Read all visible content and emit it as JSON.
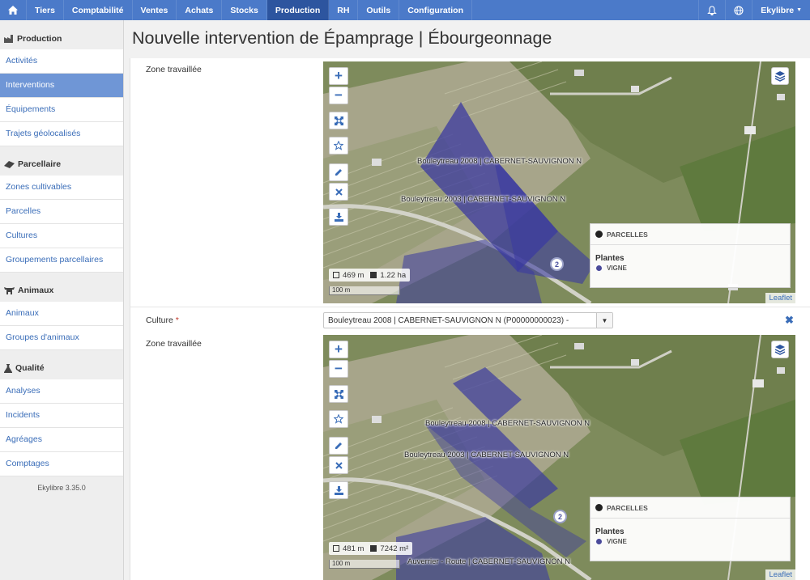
{
  "nav": {
    "items": [
      "Tiers",
      "Comptabilité",
      "Ventes",
      "Achats",
      "Stocks",
      "Production",
      "RH",
      "Outils",
      "Configuration"
    ],
    "active": "Production",
    "user": "Ekylibre"
  },
  "sidebar": {
    "sections": [
      {
        "title": "Production",
        "items": [
          "Activités",
          "Interventions",
          "Équipements",
          "Trajets géolocalisés"
        ]
      },
      {
        "title": "Parcellaire",
        "items": [
          "Zones cultivables",
          "Parcelles",
          "Cultures",
          "Groupements parcellaires"
        ]
      },
      {
        "title": "Animaux",
        "items": [
          "Animaux",
          "Groupes d'animaux"
        ]
      },
      {
        "title": "Qualité",
        "items": [
          "Analyses",
          "Incidents",
          "Agréages",
          "Comptages"
        ]
      }
    ],
    "active_item": "Interventions",
    "version": "Ekylibre 3.35.0"
  },
  "page": {
    "title": "Nouvelle intervention de Épamprage | Ébourgeonnage"
  },
  "form": {
    "zone_label": "Zone travaillée",
    "culture_label": "Culture",
    "required_mark": "*",
    "culture_value": "Bouleytreau 2008 | CABERNET-SAUVIGNON N (P00000000023) -"
  },
  "map1": {
    "labels": [
      "Bouleytreau 2008 | CABERNET-SAUVIGNON N",
      "Bouleytreau 2003 | CABERNET-SAUVIGNON N"
    ],
    "cluster": "2",
    "perimeter": "469 m",
    "area": "1.22 ha",
    "scale": "100 m",
    "legend_group": "PARCELLES",
    "legend_title": "Plantes",
    "legend_item": "VIGNE",
    "attribution": "Leaflet"
  },
  "map2": {
    "labels": [
      "Bouleytreau 2008 | CABERNET-SAUVIGNON N",
      "Bouleytreau 2003 | CABERNET-SAUVIGNON N",
      "Auverrier - Route | CABERNET-SAUVIGNON N"
    ],
    "cluster": "2",
    "perimeter": "481 m",
    "area": "7242 m²",
    "scale": "100 m",
    "legend_group": "PARCELLES",
    "legend_title": "Plantes",
    "legend_item": "VIGNE",
    "attribution": "Leaflet"
  },
  "colors": {
    "nav": "#4b7ac9",
    "nav_active": "#2d559f",
    "accent": "#3a6db8",
    "parcel": "#3b3aa0",
    "legend_dot": "#4a4a9a"
  }
}
